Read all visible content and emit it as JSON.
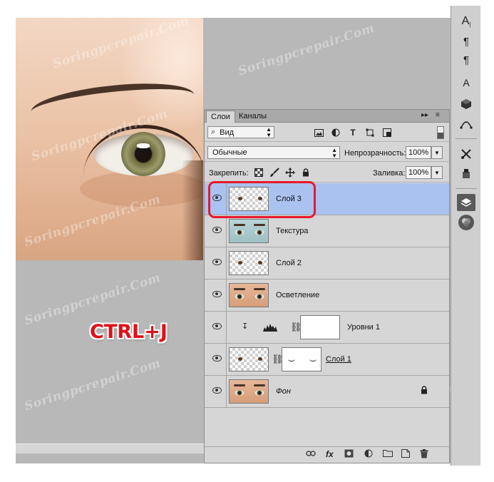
{
  "watermark": "Soringpcrepair.Com",
  "overlay": {
    "hotkey": "CTRL+J"
  },
  "colors": {
    "canvas_bg": "#b8b8b8",
    "panel_bg": "#d6d6d6",
    "selected_row": "#a9c2f0",
    "highlight_outline": "#e8192c",
    "hotkey_text": "#e01018"
  },
  "panel": {
    "tabs": [
      {
        "label": "Слои",
        "active": true
      },
      {
        "label": "Каналы",
        "active": false
      }
    ],
    "filter": {
      "value": "Вид",
      "icons": [
        "image-filter-icon",
        "adjustment-filter-icon",
        "type-filter-icon",
        "shape-filter-icon",
        "smart-object-filter-icon"
      ]
    },
    "blend_mode": "Обычные",
    "opacity_label": "Непрозрачность:",
    "opacity_value": "100%",
    "lock_label": "Закрепить:",
    "lock_icons": [
      "lock-transparent-pixels-icon",
      "lock-image-pixels-icon",
      "lock-position-icon",
      "lock-all-icon"
    ],
    "fill_label": "Заливка:",
    "fill_value": "100%",
    "layers": [
      {
        "name": "Слой 3",
        "selected": true,
        "thumb": "transparent-eyes"
      },
      {
        "name": "Текстура",
        "selected": false,
        "thumb": "eyes-teal"
      },
      {
        "name": "Слой 2",
        "selected": false,
        "thumb": "transparent-eyes"
      },
      {
        "name": "Осветление",
        "selected": false,
        "thumb": "eyes"
      },
      {
        "name": "Уровни 1",
        "selected": false,
        "thumb": "adjustment-levels"
      },
      {
        "name": "Слой 1",
        "selected": false,
        "thumb": "transparent-eyes-with-mask"
      },
      {
        "name": "Фон",
        "selected": false,
        "thumb": "eyes",
        "locked": true
      }
    ],
    "bottom_icons": [
      "link-layers-icon",
      "fx-icon",
      "add-mask-icon",
      "new-adjustment-icon",
      "new-group-icon",
      "new-layer-icon",
      "delete-layer-icon"
    ],
    "bottom_fx": "fx"
  },
  "toolbar": {
    "icons": [
      "character-icon",
      "paragraph-icon",
      "paragraph-styles-icon",
      "character-styles-icon",
      "3d-icon",
      "paths-icon",
      "tools-presets-icon",
      "clone-source-icon",
      "layers-icon",
      "channels-icon"
    ]
  }
}
